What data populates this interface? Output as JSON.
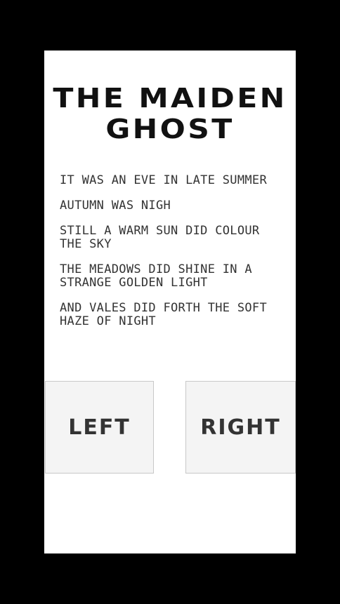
{
  "story": {
    "title_line1": "THE MAIDEN",
    "title_line2": "GHOST",
    "lines": [
      "IT WAS AN EVE IN LATE SUMMER",
      "AUTUMN WAS NIGH",
      "STILL A WARM SUN DID COLOUR THE SKY",
      "THE MEADOWS DID SHINE IN A STRANGE GOLDEN LIGHT",
      "AND VALES DID FORTH THE SOFT HAZE OF NIGHT"
    ]
  },
  "buttons": {
    "left_label": "LEFT",
    "right_label": "RIGHT"
  }
}
